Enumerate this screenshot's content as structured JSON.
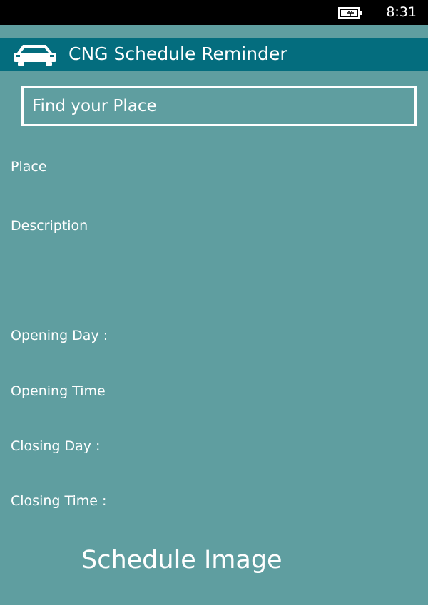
{
  "status_bar": {
    "time": "8:31",
    "battery_icon": "battery-charging-icon"
  },
  "header": {
    "title": "CNG Schedule Reminder",
    "icon": "car-icon",
    "background": "#046d7e"
  },
  "search": {
    "placeholder": "Find your Place",
    "value": ""
  },
  "fields": {
    "place_label": "Place",
    "description_label": "Description",
    "opening_day_label": "Opening Day :",
    "opening_time_label": "Opening Time",
    "closing_day_label": "Closing Day :",
    "closing_time_label": "Closing Time :"
  },
  "schedule_image": {
    "label": "Schedule Image"
  },
  "colors": {
    "page_background": "#5f9ea0",
    "status_bar": "#000000",
    "text": "#ffffff"
  }
}
